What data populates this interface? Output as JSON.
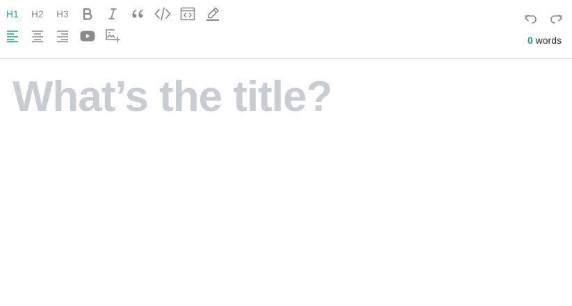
{
  "toolbar": {
    "heading1_label": "H1",
    "heading2_label": "H2",
    "heading3_label": "H3",
    "active_color": "#1f9e8f",
    "icon_color": "#8a8a8a",
    "icons": {
      "bold": "bold-icon",
      "italic": "italic-icon",
      "quote": "quote-icon",
      "code": "code-icon",
      "embed": "code-block-icon",
      "highlight": "highlighter-icon",
      "align_left": "align-left-icon",
      "align_center": "align-center-icon",
      "align_right": "align-right-icon",
      "video": "youtube-icon",
      "image": "add-image-icon",
      "undo": "undo-icon",
      "redo": "redo-icon"
    },
    "active_heading": "H1",
    "active_alignment": "left"
  },
  "status": {
    "word_count": "0",
    "word_label": "words"
  },
  "editor": {
    "title_placeholder": "What’s the title?"
  }
}
